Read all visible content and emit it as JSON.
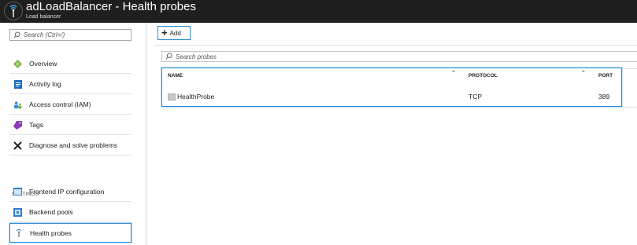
{
  "header": {
    "title": "adLoadBalancer - Health probes",
    "subtitle": "Load balancer",
    "icon": "load-balancer-probe-icon"
  },
  "sidebar": {
    "search_placeholder": "Search (Ctrl+/)",
    "items": [
      {
        "label": "Overview",
        "icon": "overview-icon"
      },
      {
        "label": "Activity log",
        "icon": "activity-log-icon"
      },
      {
        "label": "Access control (IAM)",
        "icon": "iam-icon"
      },
      {
        "label": "Tags",
        "icon": "tag-icon"
      },
      {
        "label": "Diagnose and solve problems",
        "icon": "wrench-icon"
      }
    ],
    "settings_label": "SETTINGS",
    "settings_items": [
      {
        "label": "Frontend IP configuration",
        "icon": "frontend-ip-icon"
      },
      {
        "label": "Backend pools",
        "icon": "backend-pools-icon"
      },
      {
        "label": "Health probes",
        "icon": "health-probe-icon",
        "selected": true
      }
    ]
  },
  "toolbar": {
    "add_label": "Add"
  },
  "main": {
    "search_placeholder": "Search probes",
    "columns": [
      "NAME",
      "PROTOCOL",
      "PORT"
    ],
    "rows": [
      {
        "name": "HealthProbe",
        "protocol": "TCP",
        "port": "389"
      }
    ]
  },
  "colors": {
    "titlebar": "#1f1f1f",
    "highlight": "#2a8ad4"
  }
}
